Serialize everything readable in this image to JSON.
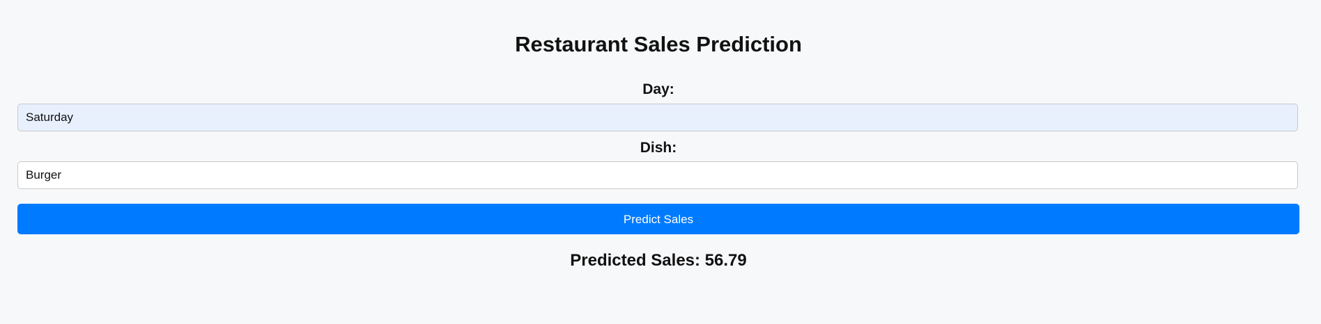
{
  "page": {
    "title": "Restaurant Sales Prediction"
  },
  "form": {
    "day_label": "Day:",
    "day_value": "Saturday",
    "dish_label": "Dish:",
    "dish_value": "Burger",
    "submit_label": "Predict Sales"
  },
  "result": {
    "text": "Predicted Sales: 56.79"
  },
  "colors": {
    "background": "#f7f8fa",
    "button": "#007bff",
    "autofill_field": "#e8f0fe"
  }
}
